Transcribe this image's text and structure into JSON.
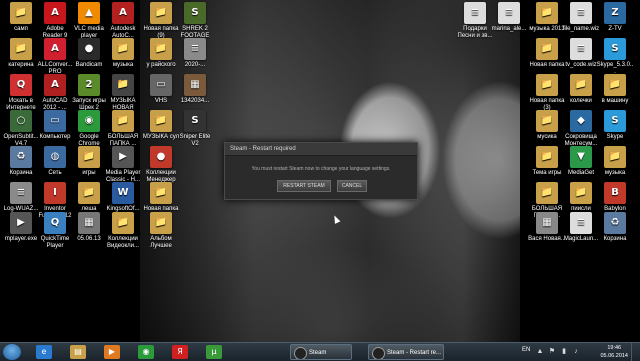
{
  "desktop": {
    "icons": [
      {
        "label": "самп",
        "name": "samp",
        "glyph": "📁",
        "color": "#c9a04a"
      },
      {
        "label": "Adobe Reader 9",
        "name": "adobe-reader",
        "glyph": "A",
        "color": "#c8161d"
      },
      {
        "label": "VLC media player",
        "name": "vlc",
        "glyph": "▲",
        "color": "#f08a00"
      },
      {
        "label": "Autodesk AutoC...",
        "name": "autodesk",
        "glyph": "A",
        "color": "#b32020"
      },
      {
        "label": "катерина",
        "name": "katerina",
        "glyph": "📁",
        "color": "#c9a04a"
      },
      {
        "label": "ALLConver... PRO",
        "name": "allconverter",
        "glyph": "A",
        "color": "#d02030"
      },
      {
        "label": "Bandicam",
        "name": "bandicam",
        "glyph": "●",
        "color": "#2a2a2a"
      },
      {
        "label": "музыка",
        "name": "muzyka-left",
        "glyph": "📁",
        "color": "#c9a04a"
      },
      {
        "label": "Искать в Интернете",
        "name": "search-internet",
        "glyph": "Q",
        "color": "#d03030"
      },
      {
        "label": "AutoCAD 2012 - ...",
        "name": "autocad",
        "glyph": "A",
        "color": "#b02020"
      },
      {
        "label": "Запуск игры Шрек 2",
        "name": "shrek2",
        "glyph": "2",
        "color": "#5a8a2a"
      },
      {
        "label": "МУЗЫКА НОВАЯ",
        "name": "muzyka-novaya",
        "glyph": "📁",
        "color": "#444"
      },
      {
        "label": "OpenSubtit... V4.7",
        "name": "opensubtitles",
        "glyph": "○",
        "color": "#3a6a3a"
      },
      {
        "label": "Компьютер",
        "name": "computer",
        "glyph": "▭",
        "color": "#3a6aa0"
      },
      {
        "label": "Google Chrome",
        "name": "chrome",
        "glyph": "◉",
        "color": "#2a9a3a"
      },
      {
        "label": "БОЛЬШАЯ ПАПКА ...",
        "name": "bolshaya-papka-left",
        "glyph": "📁",
        "color": "#c9a04a"
      },
      {
        "label": "Корзина",
        "name": "recycle-bin",
        "glyph": "♻",
        "color": "#5a7aa0"
      },
      {
        "label": "Сеть",
        "name": "network",
        "glyph": "◍",
        "color": "#3a6aa0"
      },
      {
        "label": "игры",
        "name": "igry",
        "glyph": "📁",
        "color": "#c9a04a"
      },
      {
        "label": "Media Player Classic - H...",
        "name": "mpc",
        "glyph": "▶",
        "color": "#555"
      },
      {
        "label": "Log-WUAZ... дпьт.txt",
        "name": "log-txt",
        "glyph": "≡",
        "color": "#8a8a8a"
      },
      {
        "label": "Inventor Fusion 2012",
        "name": "inventor",
        "glyph": "I",
        "color": "#c0392b"
      },
      {
        "label": "леша",
        "name": "lesha",
        "glyph": "📁",
        "color": "#c9a04a"
      },
      {
        "label": "KingsoftOf...",
        "name": "kingsoft",
        "glyph": "W",
        "color": "#2a5aa0"
      },
      {
        "label": "mplayer.exe",
        "name": "mplayer",
        "glyph": "▶",
        "color": "#555"
      },
      {
        "label": "QuickTime Player",
        "name": "quicktime",
        "glyph": "Q",
        "color": "#3a80c0"
      },
      {
        "label": "05.06.13",
        "name": "date-folder",
        "glyph": "▦",
        "color": "#777"
      },
      {
        "label": "Коллекции Видеокли...",
        "name": "video-collections",
        "glyph": "📁",
        "color": "#c9a04a"
      },
      {
        "label": "Новая папка (9)",
        "name": "novaya-papka-9",
        "glyph": "📁",
        "color": "#c9a04a"
      },
      {
        "label": "SHREK 2 FOOTAGE",
        "name": "shrek-footage",
        "glyph": "S",
        "color": "#4a6a2a"
      },
      {
        "label": "у райского",
        "name": "u-rayskogo",
        "glyph": "📁",
        "color": "#c9a04a"
      },
      {
        "label": "2020-...",
        "name": "file-2020",
        "glyph": "≡",
        "color": "#8a8a8a"
      },
      {
        "label": "VHS",
        "name": "vhs",
        "glyph": "▭",
        "color": "#666"
      },
      {
        "label": "1342034...",
        "name": "img-1342",
        "glyph": "▦",
        "color": "#7a5a3a"
      },
      {
        "label": "МУЗЫКА сул",
        "name": "muzyka-sul",
        "glyph": "📁",
        "color": "#c9a04a"
      },
      {
        "label": "Sniper Elite V2",
        "name": "sniper-elite",
        "glyph": "S",
        "color": "#333"
      },
      {
        "label": "Коллекции Менеджер",
        "name": "collections-manager",
        "glyph": "●",
        "color": "#c0392b"
      },
      {
        "label": "Новая папка",
        "name": "novaya-papka-mid",
        "glyph": "📁",
        "color": "#c9a04a"
      },
      {
        "label": "Альбом Лучшее",
        "name": "album-best",
        "glyph": "📁",
        "color": "#c9a04a"
      },
      {
        "label": "Подарки Песни и зв...",
        "name": "podarki",
        "glyph": "≡",
        "color": "#ddd"
      },
      {
        "label": "marina_ale...",
        "name": "marina-ale",
        "glyph": "≡",
        "color": "#ddd"
      },
      {
        "label": "музыка 2013",
        "name": "muzyka-2013",
        "glyph": "📁",
        "color": "#c9a04a"
      },
      {
        "label": "file_name.wiz",
        "name": "file-name-wiz",
        "glyph": "≡",
        "color": "#ddd"
      },
      {
        "label": "Z-TV",
        "name": "z-tv",
        "glyph": "Z",
        "color": "#2a6aa0"
      },
      {
        "label": "Новая папка",
        "name": "novaya-papka-right",
        "glyph": "📁",
        "color": "#c9a04a"
      },
      {
        "label": "tv_code.wiz",
        "name": "tv-code",
        "glyph": "≡",
        "color": "#ddd"
      },
      {
        "label": "Skype_5.3.0...",
        "name": "skype-installer",
        "glyph": "S",
        "color": "#2a9ad8"
      },
      {
        "label": "Новая папка (3)",
        "name": "novaya-papka-3",
        "glyph": "📁",
        "color": "#c9a04a"
      },
      {
        "label": "колечки",
        "name": "kolechki",
        "glyph": "📁",
        "color": "#c9a04a"
      },
      {
        "label": "в машину",
        "name": "v-mashinu",
        "glyph": "📁",
        "color": "#c9a04a"
      },
      {
        "label": "мусика",
        "name": "musika",
        "glyph": "📁",
        "color": "#c9a04a"
      },
      {
        "label": "Сокровища Монтесум...",
        "name": "montezuma",
        "glyph": "◆",
        "color": "#2a6aa0"
      },
      {
        "label": "Skype",
        "name": "skype",
        "glyph": "S",
        "color": "#2a9ad8"
      },
      {
        "label": "Тема игры",
        "name": "tema-igry",
        "glyph": "📁",
        "color": "#c9a04a"
      },
      {
        "label": "MediaGet",
        "name": "mediaget",
        "glyph": "▼",
        "color": "#2a9a4a"
      },
      {
        "label": "музыка",
        "name": "muzyka-right",
        "glyph": "📁",
        "color": "#c9a04a"
      },
      {
        "label": "БОЛЬШАЯ ПАПКА ...",
        "name": "bolshaya-papka-right",
        "glyph": "📁",
        "color": "#c9a04a"
      },
      {
        "label": "пиисли артем",
        "name": "piisli-artem",
        "glyph": "📁",
        "color": "#c9a04a"
      },
      {
        "label": "Babylon",
        "name": "babylon",
        "glyph": "B",
        "color": "#c0392b"
      },
      {
        "label": "Вася Новая...",
        "name": "vasya",
        "glyph": "▦",
        "color": "#888"
      },
      {
        "label": "MagicLaun...",
        "name": "magiclauncher",
        "glyph": "≡",
        "color": "#ddd"
      },
      {
        "label": "Корзина",
        "name": "recycle-bin-right",
        "glyph": "♻",
        "color": "#5a7aa0"
      }
    ]
  },
  "dialog": {
    "title": "Steam - Restart required",
    "message": "You must restart Steam now to change your language settings.",
    "restart_label": "RESTART STEAM",
    "cancel_label": "CANCEL"
  },
  "taskbar": {
    "pinned": [
      {
        "name": "ie",
        "glyph": "e",
        "color": "#2a7ad0"
      },
      {
        "name": "explorer",
        "glyph": "▤",
        "color": "#c9a04a"
      },
      {
        "name": "media-player",
        "glyph": "▶",
        "color": "#e07a20"
      },
      {
        "name": "chrome",
        "glyph": "◉",
        "color": "#2a9a3a"
      },
      {
        "name": "yandex",
        "glyph": "Я",
        "color": "#d02020"
      },
      {
        "name": "utorrent",
        "glyph": "µ",
        "color": "#3a9a3a"
      }
    ],
    "tasks": [
      {
        "name": "steam-task",
        "label": "Steam"
      },
      {
        "name": "steam-restart-task",
        "label": "Steam - Restart re..."
      }
    ],
    "tray": {
      "language": "EN",
      "time": "19:46",
      "date": "05.06.2014"
    }
  }
}
